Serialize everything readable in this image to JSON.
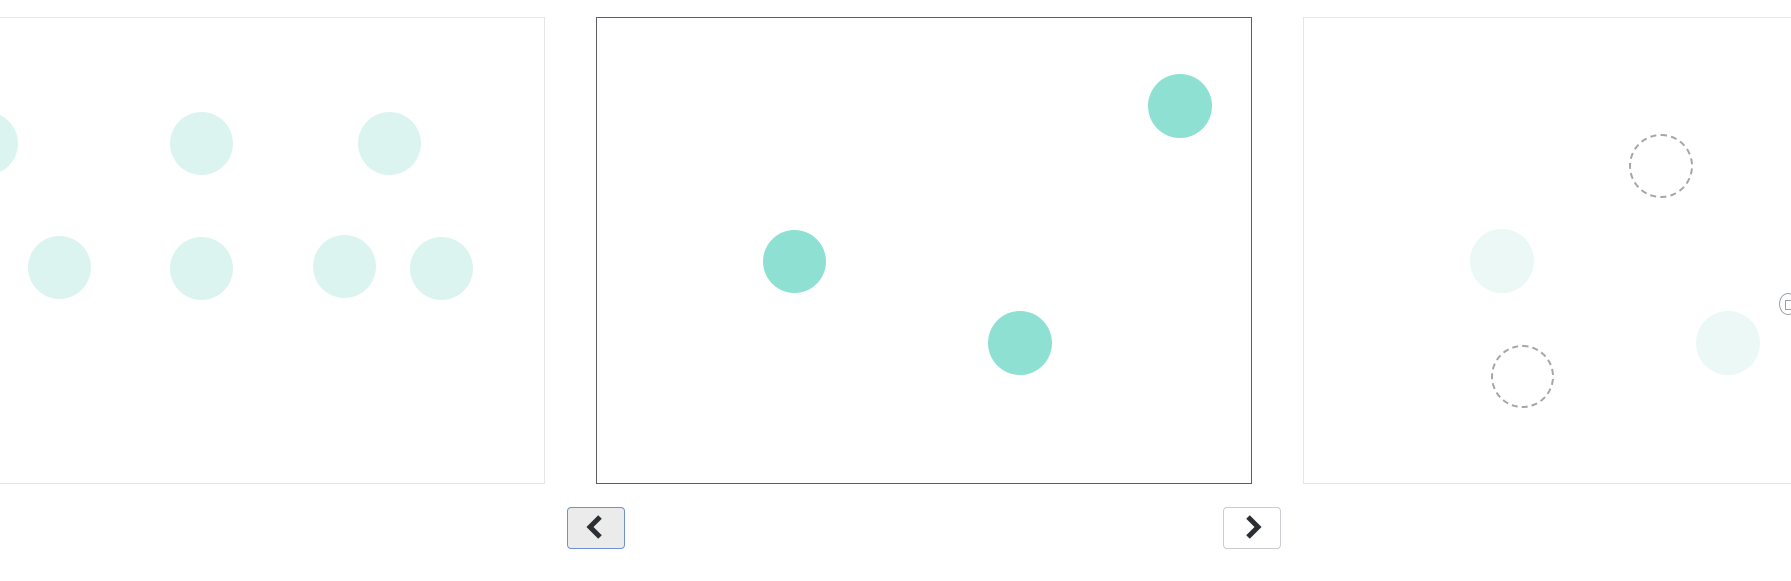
{
  "carousel": {
    "slides": [
      {
        "id": "previous-slide",
        "dots": [
          "faint",
          "faint",
          "faint",
          "faint",
          "faint",
          "faint",
          "faint"
        ]
      },
      {
        "id": "current-slide",
        "dots": [
          "solid",
          "solid",
          "solid"
        ]
      },
      {
        "id": "next-slide",
        "dots": [
          "dashed",
          "ghost",
          "dashed",
          "ghost"
        ]
      }
    ],
    "nav": {
      "prev_icon": "chevron-left-icon",
      "next_icon": "chevron-right-icon"
    }
  },
  "colors": {
    "dot_solid": "#8ee0d3",
    "dot_faint": "#dcf4ef",
    "dot_ghost": "#ebf8f6",
    "dot_dashed_border": "#a6a6a6",
    "active_border": "#6f8fd6"
  }
}
